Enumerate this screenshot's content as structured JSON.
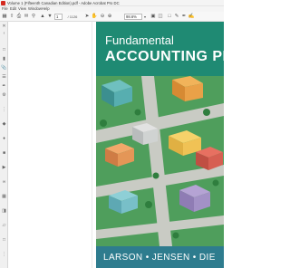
{
  "window": {
    "title": "Volume 1 (Fifteenth Canadian Edition).pdf - Adobe Acrobat Pro DC"
  },
  "menubar": {
    "items": [
      "File",
      "Edit",
      "View",
      "Window",
      "Help"
    ]
  },
  "toolbar": {
    "page_current": "1",
    "page_total": "/ 1126",
    "zoom_level": "98.6%"
  },
  "cover": {
    "subtitle": "Fundamental",
    "title": "ACCOUNTING PRIN",
    "authors": "LARSON • JENSEN • DIE"
  },
  "colors": {
    "cover_teal": "#1f8a73",
    "cover_green": "#4a9b5a",
    "cover_footer": "#2e7c8e",
    "acrobat_red": "#d4291f"
  }
}
